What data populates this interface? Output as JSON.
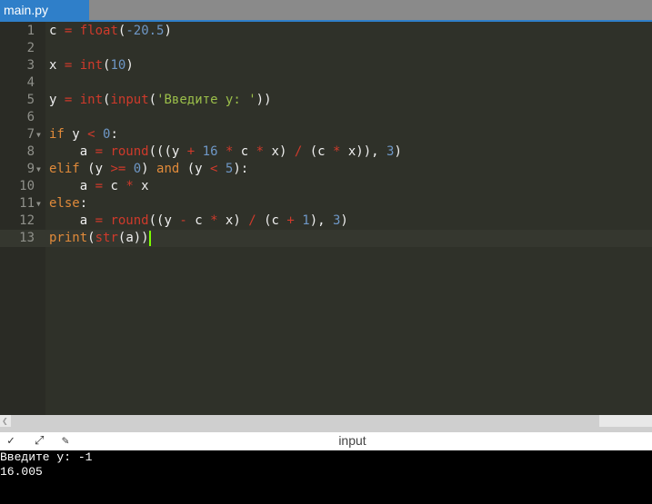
{
  "tab": {
    "label": "main.py"
  },
  "editor": {
    "active_line": 13,
    "lines": [
      {
        "n": "1",
        "fold": false,
        "tokens": [
          [
            "c",
            "id"
          ],
          [
            " ",
            ""
          ],
          [
            "=",
            "op"
          ],
          [
            " ",
            ""
          ],
          [
            "float",
            "fn"
          ],
          [
            "(",
            "id"
          ],
          [
            "-20.5",
            "num"
          ],
          [
            ")",
            "id"
          ]
        ]
      },
      {
        "n": "2",
        "fold": false,
        "tokens": []
      },
      {
        "n": "3",
        "fold": false,
        "tokens": [
          [
            "x",
            "id"
          ],
          [
            " ",
            ""
          ],
          [
            "=",
            "op"
          ],
          [
            " ",
            ""
          ],
          [
            "int",
            "fn"
          ],
          [
            "(",
            "id"
          ],
          [
            "10",
            "num"
          ],
          [
            ")",
            "id"
          ]
        ]
      },
      {
        "n": "4",
        "fold": false,
        "tokens": []
      },
      {
        "n": "5",
        "fold": false,
        "tokens": [
          [
            "y",
            "id"
          ],
          [
            " ",
            ""
          ],
          [
            "=",
            "op"
          ],
          [
            " ",
            ""
          ],
          [
            "int",
            "fn"
          ],
          [
            "(",
            "id"
          ],
          [
            "input",
            "fn"
          ],
          [
            "(",
            "id"
          ],
          [
            "'Введите y: '",
            "str"
          ],
          [
            "))",
            "id"
          ]
        ]
      },
      {
        "n": "6",
        "fold": false,
        "tokens": []
      },
      {
        "n": "7",
        "fold": true,
        "tokens": [
          [
            "if",
            "kw"
          ],
          [
            " y ",
            "id"
          ],
          [
            "<",
            "op"
          ],
          [
            " ",
            ""
          ],
          [
            "0",
            "num"
          ],
          [
            ":",
            "id"
          ]
        ]
      },
      {
        "n": "8",
        "fold": false,
        "tokens": [
          [
            "    a ",
            "id"
          ],
          [
            "=",
            "op"
          ],
          [
            " ",
            ""
          ],
          [
            "round",
            "fn"
          ],
          [
            "(((y ",
            "id"
          ],
          [
            "+",
            "op"
          ],
          [
            " ",
            ""
          ],
          [
            "16",
            "num"
          ],
          [
            " ",
            ""
          ],
          [
            "*",
            "op"
          ],
          [
            " c ",
            "id"
          ],
          [
            "*",
            "op"
          ],
          [
            " x) ",
            "id"
          ],
          [
            "/",
            "op"
          ],
          [
            " (c ",
            "id"
          ],
          [
            "*",
            "op"
          ],
          [
            " x)), ",
            "id"
          ],
          [
            "3",
            "num"
          ],
          [
            ")",
            "id"
          ]
        ]
      },
      {
        "n": "9",
        "fold": true,
        "tokens": [
          [
            "elif",
            "kw"
          ],
          [
            " (y ",
            "id"
          ],
          [
            ">=",
            "op"
          ],
          [
            " ",
            ""
          ],
          [
            "0",
            "num"
          ],
          [
            ") ",
            "id"
          ],
          [
            "and",
            "kw"
          ],
          [
            " (y ",
            "id"
          ],
          [
            "<",
            "op"
          ],
          [
            " ",
            ""
          ],
          [
            "5",
            "num"
          ],
          [
            "):",
            "id"
          ]
        ]
      },
      {
        "n": "10",
        "fold": false,
        "tokens": [
          [
            "    a ",
            "id"
          ],
          [
            "=",
            "op"
          ],
          [
            " c ",
            "id"
          ],
          [
            "*",
            "op"
          ],
          [
            " x",
            "id"
          ]
        ]
      },
      {
        "n": "11",
        "fold": true,
        "tokens": [
          [
            "else",
            "kw"
          ],
          [
            ":",
            "id"
          ]
        ]
      },
      {
        "n": "12",
        "fold": false,
        "tokens": [
          [
            "    a ",
            "id"
          ],
          [
            "=",
            "op"
          ],
          [
            " ",
            ""
          ],
          [
            "round",
            "fn"
          ],
          [
            "((y ",
            "id"
          ],
          [
            "-",
            "op"
          ],
          [
            " c ",
            "id"
          ],
          [
            "*",
            "op"
          ],
          [
            " x) ",
            "id"
          ],
          [
            "/",
            "op"
          ],
          [
            " (c ",
            "id"
          ],
          [
            "+",
            "op"
          ],
          [
            " ",
            ""
          ],
          [
            "1",
            "num"
          ],
          [
            "), ",
            "id"
          ],
          [
            "3",
            "num"
          ],
          [
            ")",
            "id"
          ]
        ]
      },
      {
        "n": "13",
        "fold": false,
        "tokens": [
          [
            "print",
            "kw"
          ],
          [
            "(",
            "id"
          ],
          [
            "str",
            "fn"
          ],
          [
            "(a))",
            "id"
          ]
        ]
      }
    ]
  },
  "panel": {
    "title": "input",
    "icons": [
      "chevron-down-icon",
      "expand-icon",
      "clear-icon"
    ]
  },
  "console": {
    "lines": [
      "Введите y: -1",
      "16.005"
    ]
  },
  "colors": {
    "accent": "#2f7fc9",
    "editor_bg": "#2f3129",
    "cursor": "#7cfc00"
  }
}
